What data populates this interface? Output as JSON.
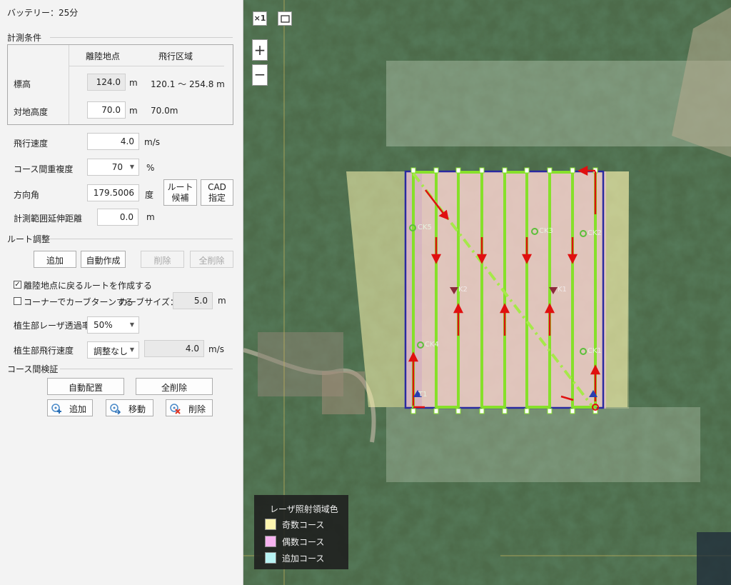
{
  "battery": "バッテリー：25分",
  "measurement": {
    "section_title": "計測条件",
    "col_takeoff": "離陸地点",
    "col_area": "飛行区域",
    "elevation_label": "標高",
    "elevation_value": "124.0",
    "elevation_unit": "m",
    "elevation_range": "120.1 ～ 254.8 m",
    "agl_label": "対地高度",
    "agl_value": "70.0",
    "agl_unit": "m",
    "agl_area": "70.0m",
    "speed_label": "飛行速度",
    "speed_value": "4.0",
    "speed_unit": "m/s",
    "overlap_label": "コース間重複度",
    "overlap_value": "70",
    "overlap_unit": "%",
    "heading_label": "方向角",
    "heading_value": "179.5006",
    "heading_unit": "度",
    "route_candidate_btn": "ルート\n候補",
    "cad_btn": "CAD\n指定",
    "extend_label": "計測範囲延伸距離",
    "extend_value": "0.0",
    "extend_unit": "m"
  },
  "route": {
    "section_title": "ルート調整",
    "add_btn": "追加",
    "auto_btn": "自動作成",
    "delete_btn": "削除",
    "delete_all_btn": "全削除",
    "return_check_label": "離陸地点に戻るルートを作成する",
    "return_checked": true,
    "curve_check_label": "コーナーでカーブターンする",
    "curve_checked": false,
    "curve_size_label": "カーブサイズ：",
    "curve_size_value": "5.0",
    "curve_size_unit": "m",
    "veg_rate_label": "植生部レーザ透過率",
    "veg_rate_value": "50%",
    "veg_speed_label": "植生部飛行速度",
    "veg_speed_value": "調整なし",
    "veg_speed_num": "4.0",
    "veg_speed_unit": "m/s"
  },
  "verify": {
    "section_title": "コース間検証",
    "auto_place_btn": "自動配置",
    "delete_all_btn": "全削除",
    "add_btn": "追加",
    "move_btn": "移動",
    "delete_btn": "削除"
  },
  "map": {
    "scale_btn": "×1",
    "zoom_in": "+",
    "zoom_out": "−",
    "markers": [
      "CK5",
      "CK3",
      "CK2",
      "K2",
      "K1",
      "CK4",
      "CK1",
      "T1"
    ],
    "legend_title": "レーザ照射領域色",
    "legend_items": [
      {
        "label": "奇数コース",
        "color": "#fdf5b0"
      },
      {
        "label": "偶数コース",
        "color": "#f7b3f0"
      },
      {
        "label": "追加コース",
        "color": "#b8f3f3"
      }
    ]
  }
}
